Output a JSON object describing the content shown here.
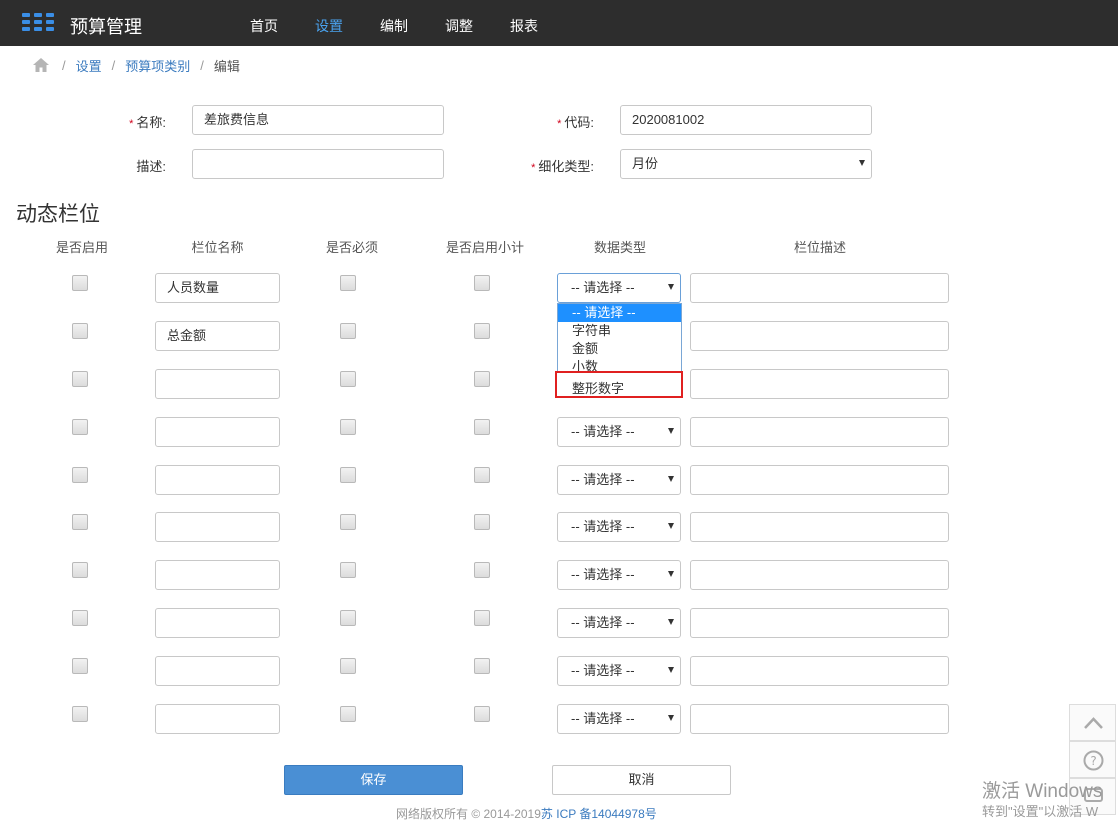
{
  "navbar": {
    "title": "预算管理",
    "items": [
      {
        "label": "首页",
        "active": false
      },
      {
        "label": "设置",
        "active": true
      },
      {
        "label": "编制",
        "active": false
      },
      {
        "label": "调整",
        "active": false
      },
      {
        "label": "报表",
        "active": false
      }
    ]
  },
  "breadcrumb": {
    "items": [
      "设置",
      "预算项类别"
    ],
    "current": "编辑",
    "separator": "/"
  },
  "form": {
    "name_label": "名称:",
    "name_value": "差旅费信息",
    "code_label": "代码:",
    "code_value": "2020081002",
    "desc_label": "描述:",
    "desc_value": "",
    "subtype_label": "细化类型:",
    "subtype_value": "月份",
    "required_mark": "*"
  },
  "dynamic_fields": {
    "title": "动态栏位",
    "columns": [
      "是否启用",
      "栏位名称",
      "是否必须",
      "是否启用小计",
      "数据类型",
      "栏位描述"
    ],
    "type_placeholder": "-- 请选择 --",
    "rows": [
      {
        "name": "人员数量",
        "type": "-- 请选择 --",
        "dropdown_open": true
      },
      {
        "name": "总金额",
        "type": "",
        "dropdown_open": false
      },
      {
        "name": "",
        "type": "",
        "dropdown_open": false
      },
      {
        "name": "",
        "type": "-- 请选择 --",
        "dropdown_open": false
      },
      {
        "name": "",
        "type": "-- 请选择 --",
        "dropdown_open": false
      },
      {
        "name": "",
        "type": "-- 请选择 --",
        "dropdown_open": false
      },
      {
        "name": "",
        "type": "-- 请选择 --",
        "dropdown_open": false
      },
      {
        "name": "",
        "type": "-- 请选择 --",
        "dropdown_open": false
      },
      {
        "name": "",
        "type": "-- 请选择 --",
        "dropdown_open": false
      },
      {
        "name": "",
        "type": "-- 请选择 --",
        "dropdown_open": false
      }
    ],
    "dropdown_options": [
      "-- 请选择 --",
      "字符串",
      "金额",
      "小数",
      "整形数字"
    ],
    "highlighted_option": "整形数字"
  },
  "buttons": {
    "save": "保存",
    "cancel": "取消"
  },
  "footer": {
    "text": "网络版权所有 © 2014-2019",
    "icp": "苏 ICP 备14044978号"
  },
  "watermark": {
    "line1": "激活 Windows",
    "line2": "转到\"设置\"以激活 W"
  },
  "colors": {
    "navbar_bg": "#2d2d2d",
    "accent": "#4aa3f0",
    "link": "#3b7bbf",
    "primary_button": "#4a8fd4",
    "required": "#d0021b",
    "highlight_border": "#e02020"
  }
}
